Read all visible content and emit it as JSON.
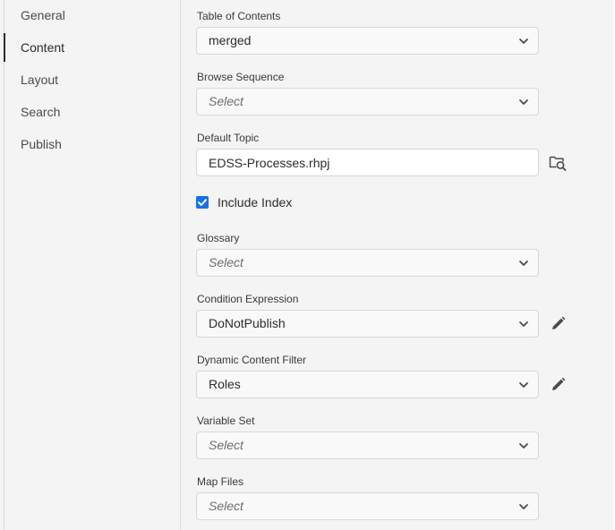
{
  "sidebar": {
    "items": [
      {
        "label": "General"
      },
      {
        "label": "Content"
      },
      {
        "label": "Layout"
      },
      {
        "label": "Search"
      },
      {
        "label": "Publish"
      }
    ],
    "active": "Content"
  },
  "content": {
    "toc": {
      "label": "Table of Contents",
      "value": "merged"
    },
    "browse_sequence": {
      "label": "Browse Sequence",
      "placeholder": "Select"
    },
    "default_topic": {
      "label": "Default Topic",
      "value": "EDSS-Processes.rhpj"
    },
    "include_index": {
      "label": "Include Index",
      "checked": true
    },
    "glossary": {
      "label": "Glossary",
      "placeholder": "Select"
    },
    "condition_expression": {
      "label": "Condition Expression",
      "value": "DoNotPublish"
    },
    "dynamic_content_filter": {
      "label": "Dynamic Content Filter",
      "value": "Roles"
    },
    "variable_set": {
      "label": "Variable Set",
      "placeholder": "Select"
    },
    "map_files": {
      "label": "Map Files",
      "placeholder": "Select"
    }
  },
  "icons": {
    "browse": "folder-search-icon",
    "edit": "pencil-icon",
    "dropdown": "chevron-down-icon",
    "check": "checkmark-icon"
  },
  "colors": {
    "accent": "#1473e6",
    "background": "#f4f4f4"
  }
}
